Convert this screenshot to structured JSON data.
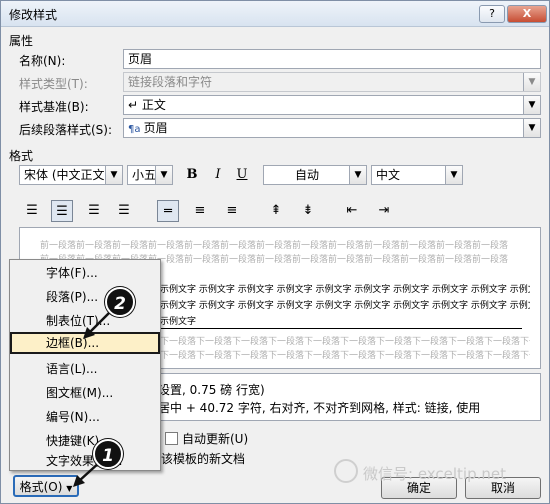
{
  "window": {
    "title": "修改样式",
    "help_button": "?",
    "close_button": "X"
  },
  "properties": {
    "section_label": "属性",
    "name_label": "名称(N):",
    "name_value": "页眉",
    "type_label": "样式类型(T):",
    "type_value": "链接段落和字符",
    "based_on_label": "样式基准(B):",
    "based_on_value": "正文",
    "next_label": "后续段落样式(S):",
    "next_value": "页眉"
  },
  "format": {
    "section_label": "格式",
    "font_value": "宋体 (中文正文)",
    "size_value": "小五",
    "bold": "B",
    "italic": "I",
    "underline": "U",
    "color_value": "自动",
    "lang_value": "中文"
  },
  "preview": {
    "prev_para": "前一段落前一段落前一段落前一段落前一段落前一段落前一段落前一段落前一段落前一段落前一段落前一段落前一段落",
    "prev_tail": "前一段落",
    "sample": "示例文字 示例文字 示例文字 示例文字 示例文字 示例文字 示例文字 示例文字 示例文字 示例文字 示例文字",
    "sample_tail": "示例文字",
    "next_para": "下一段落下一段落下一段落下一段落下一段落下一段落下一段落下一段落下一段落下一段落下一段落下一段落"
  },
  "description": {
    "line1": "设置, 0.75 磅 行宽)",
    "line2": "居中 + 40.72 字符, 右对齐, 不对齐到网格, 样式: 链接, 使用"
  },
  "options": {
    "auto_update": "自动更新(U)",
    "template_docs": "该模板的新文档"
  },
  "buttons": {
    "format": "格式(O)",
    "ok": "确定",
    "cancel": "取消"
  },
  "menu": {
    "items": [
      "字体(F)...",
      "段落(P)...",
      "制表位(T)...",
      "边框(B)...",
      "语言(L)...",
      "图文框(M)...",
      "编号(N)...",
      "快捷键(K)...",
      "文字效果(E)..."
    ]
  },
  "callouts": {
    "step1": "1",
    "step2": "2"
  },
  "watermark": "微信号: exceltip.net",
  "colors": {
    "highlight": "#fdf0c8",
    "title_bar": "#d8e3f0"
  }
}
